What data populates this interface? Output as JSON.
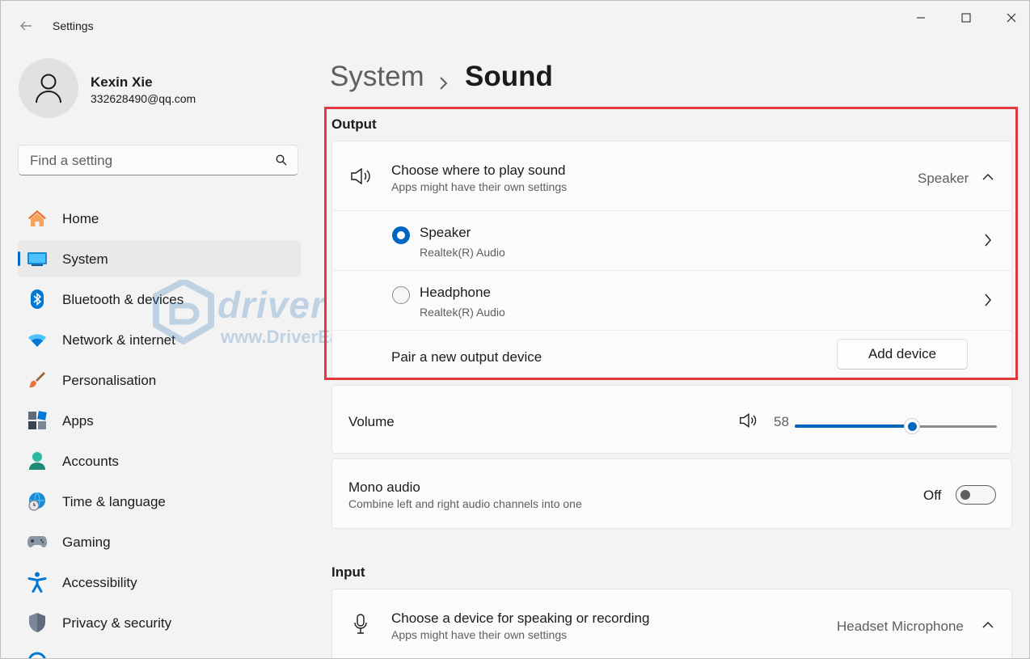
{
  "window": {
    "title": "Settings"
  },
  "user": {
    "name": "Kexin Xie",
    "email": "332628490@qq.com"
  },
  "search": {
    "placeholder": "Find a setting"
  },
  "nav": [
    {
      "label": "Home",
      "icon": "home-icon"
    },
    {
      "label": "System",
      "icon": "system-icon",
      "active": true
    },
    {
      "label": "Bluetooth & devices",
      "icon": "bluetooth-icon"
    },
    {
      "label": "Network & internet",
      "icon": "wifi-icon"
    },
    {
      "label": "Personalisation",
      "icon": "brush-icon"
    },
    {
      "label": "Apps",
      "icon": "apps-icon"
    },
    {
      "label": "Accounts",
      "icon": "accounts-icon"
    },
    {
      "label": "Time & language",
      "icon": "globe-clock-icon"
    },
    {
      "label": "Gaming",
      "icon": "gamepad-icon"
    },
    {
      "label": "Accessibility",
      "icon": "accessibility-icon"
    },
    {
      "label": "Privacy & security",
      "icon": "shield-icon"
    }
  ],
  "breadcrumb": {
    "parent": "System",
    "current": "Sound"
  },
  "output": {
    "section_title": "Output",
    "choose_title": "Choose where to play sound",
    "choose_subtitle": "Apps might have their own settings",
    "selected_device": "Speaker",
    "devices": [
      {
        "name": "Speaker",
        "driver": "Realtek(R) Audio",
        "selected": true
      },
      {
        "name": "Headphone",
        "driver": "Realtek(R) Audio",
        "selected": false
      }
    ],
    "pair_label": "Pair a new output device",
    "add_device_label": "Add device"
  },
  "volume": {
    "label": "Volume",
    "value": 58,
    "value_text": "58",
    "slider_percent": 58
  },
  "mono": {
    "title": "Mono audio",
    "subtitle": "Combine left and right audio channels into one",
    "state_label": "Off",
    "on": false
  },
  "input": {
    "section_title": "Input",
    "choose_title": "Choose a device for speaking or recording",
    "choose_subtitle": "Apps might have their own settings",
    "selected_device": "Headset Microphone"
  },
  "watermark": {
    "brand": "driver easy",
    "url": "www.DriverEasy.com"
  },
  "colors": {
    "accent": "#0067c0",
    "highlight": "#e5373f"
  }
}
